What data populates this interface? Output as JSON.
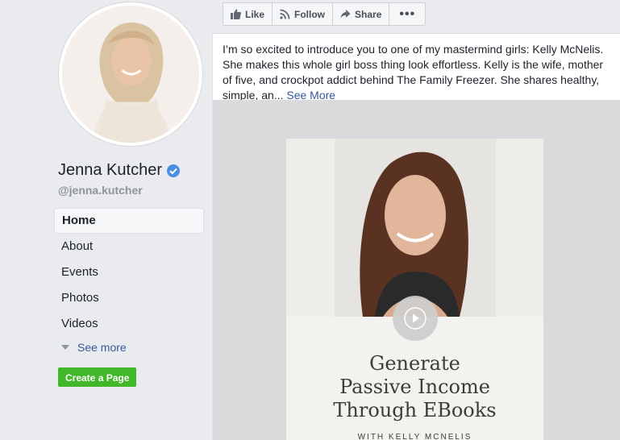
{
  "profile": {
    "name": "Jenna Kutcher",
    "username": "@jenna.kutcher",
    "verified": true
  },
  "nav": {
    "items": [
      {
        "label": "Home",
        "active": true
      },
      {
        "label": "About",
        "active": false
      },
      {
        "label": "Events",
        "active": false
      },
      {
        "label": "Photos",
        "active": false
      },
      {
        "label": "Videos",
        "active": false
      }
    ],
    "see_more": "See more"
  },
  "create_page": "Create a Page",
  "actions": {
    "like": "Like",
    "follow": "Follow",
    "share": "Share",
    "more": "•••"
  },
  "post": {
    "text": "I’m so excited to introduce you to one of my mastermind girls: Kelly McNelis. She makes this whole girl boss thing look effortless. Kelly is the wife, mother of five, and crockpot addict behind The Family Freezer. She shares healthy, simple, an...",
    "see_more": "See More",
    "media": {
      "title_lines": [
        "Generate",
        "Passive Income",
        "Through EBooks"
      ],
      "subtitle": "WITH KELLY MCNELIS"
    }
  },
  "colors": {
    "background": "#e9ebee",
    "link": "#365899",
    "create_page_green": "#42b72a",
    "verified_blue": "#4a90e2"
  },
  "icons": [
    "verified-badge-icon",
    "like-icon",
    "follow-icon",
    "share-icon",
    "more-icon",
    "caret-down-icon",
    "play-icon"
  ]
}
